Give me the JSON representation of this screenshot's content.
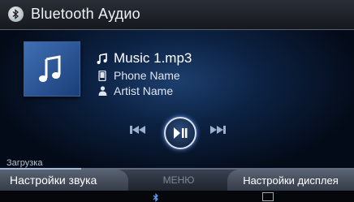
{
  "header": {
    "title": "Bluetooth Аудио",
    "icon": "bluetooth-icon"
  },
  "track": {
    "title": "Music 1.mp3",
    "device": "Phone Name",
    "artist": "Artist Name"
  },
  "controls": {
    "prev_icon": "previous-track-icon",
    "play_icon": "play-pause-icon",
    "next_icon": "next-track-icon"
  },
  "status": {
    "loading_label": "Загрузка",
    "progress": 0.23
  },
  "bottom_bar": {
    "sound_settings": "Настройки звука",
    "menu": "МЕНЮ",
    "display_settings": "Настройки дисплея"
  },
  "colors": {
    "accent": "#1f4d8f",
    "glow": "#6fa0ff"
  }
}
